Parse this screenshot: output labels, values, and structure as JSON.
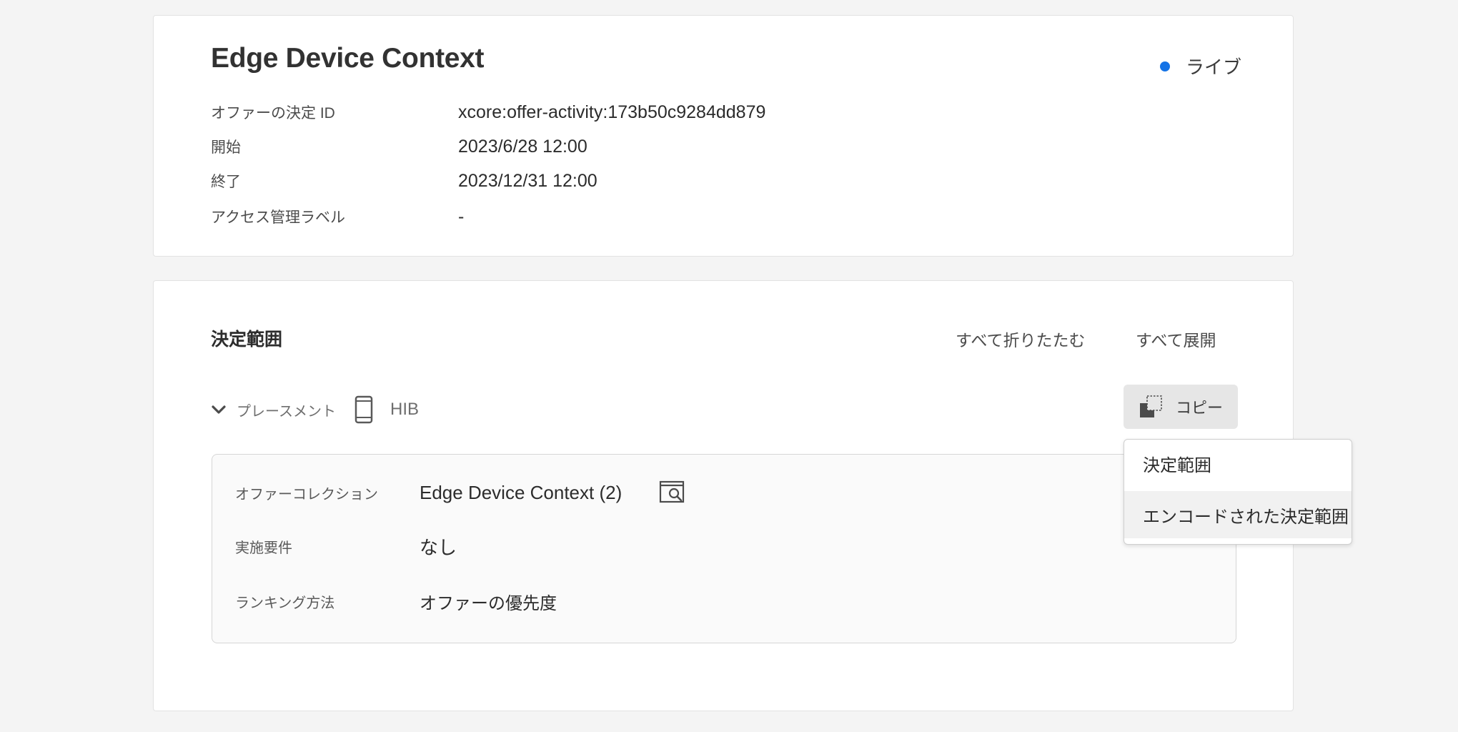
{
  "header": {
    "title": "Edge Device Context",
    "status": {
      "label": "ライブ",
      "color": "#1473e6"
    }
  },
  "meta": [
    {
      "label": "オファーの決定 ID",
      "value": "xcore:offer-activity:173b50c9284dd879"
    },
    {
      "label": "開始",
      "value": "2023/6/28 12:00"
    },
    {
      "label": "終了",
      "value": "2023/12/31 12:00"
    },
    {
      "label": "アクセス管理ラベル",
      "value": "-"
    }
  ],
  "scopes": {
    "title": "決定範囲",
    "collapse_all": "すべて折りたたむ",
    "expand_all": "すべて展開",
    "placement": {
      "label": "プレースメント",
      "icon": "mobile-phone-icon",
      "name": "HIB"
    },
    "copy_button": {
      "label": "コピー",
      "icon": "copy-icon"
    },
    "details": [
      {
        "label": "オファーコレクション",
        "value": "Edge Device Context (2)"
      },
      {
        "label": "実施要件",
        "value": "なし"
      },
      {
        "label": "ランキング方法",
        "value": "オファーの優先度"
      }
    ],
    "copy_menu": {
      "items": [
        "決定範囲",
        "エンコードされた決定範囲"
      ],
      "highlighted_index": 1
    }
  }
}
